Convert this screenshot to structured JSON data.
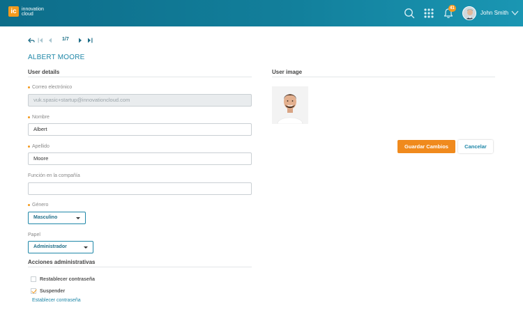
{
  "header": {
    "logo_mark": "ic",
    "logo_line1": "innovation",
    "logo_line2": "cloud",
    "notification_count": "41",
    "user_name": "John Smith",
    "icons": [
      "search-icon",
      "apps-grid-icon",
      "bell-icon",
      "chevron-down-icon"
    ]
  },
  "pager": {
    "count": "1/7",
    "icons": [
      "back-arrow-icon",
      "first-page-icon",
      "previous-icon",
      "next-icon",
      "last-page-icon"
    ]
  },
  "person_name": "ALBERT MOORE",
  "sections": {
    "user_details": "User details",
    "user_image": "User image",
    "admin_actions": "Acciones administrativas"
  },
  "form": {
    "email_label": "Correo electrónico",
    "email_value": "vuk.spasic+startup@innovationcloud.com",
    "first_name_label": "Nombre",
    "first_name_value": "Albert",
    "last_name_label": "Apellido",
    "last_name_value": "Moore",
    "role_in_company_label": "Función en la compañía",
    "role_in_company_value": "",
    "gender_label": "Género",
    "gender_value": "Masculino",
    "role_label": "Papel",
    "role_value": "Administrador"
  },
  "admin_actions": {
    "reset_password": {
      "label": "Restablecer contraseña",
      "checked": false
    },
    "suspend": {
      "label": "Suspender",
      "checked": true
    },
    "set_password_link": "Establecer contraseña"
  },
  "buttons": {
    "save": "Guardar Cambios",
    "cancel": "Cancelar"
  },
  "colors": {
    "header_start": "#0d6d8a",
    "header_end": "#1a96b3",
    "accent_orange": "#f08a1d",
    "link_blue": "#1f87a8"
  }
}
